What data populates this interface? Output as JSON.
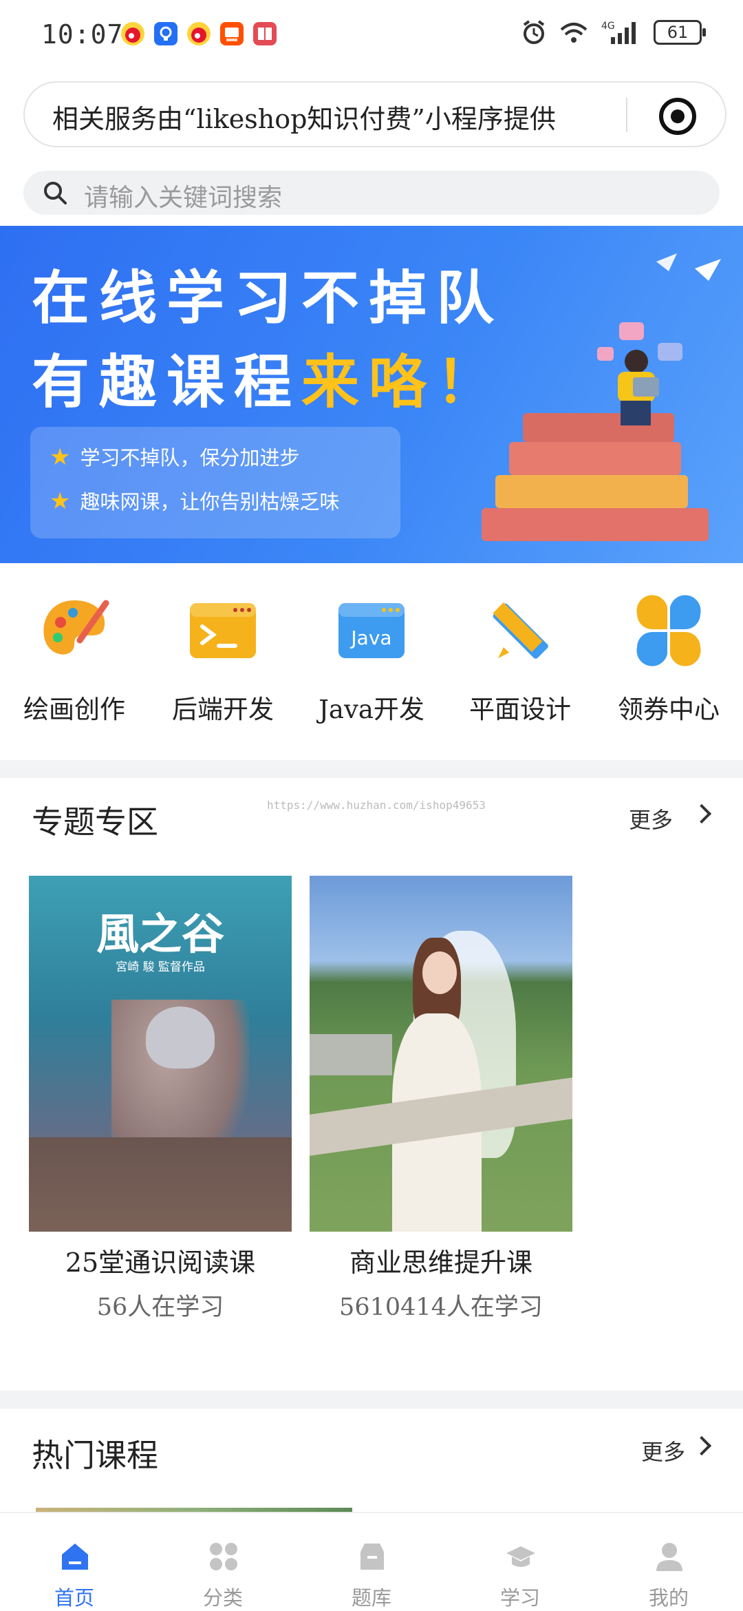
{
  "status_bar": {
    "time": "10:07",
    "battery": "61",
    "network": "4G"
  },
  "mini_program": {
    "text": "相关服务由“likeshop知识付费”小程序提供"
  },
  "search": {
    "placeholder": "请输入关键词搜索"
  },
  "banner": {
    "line1": "在线学习不掉队",
    "line2_prefix": "有趣课程",
    "line2_accent": "来咯！",
    "points": [
      "学习不掉队，保分加进步",
      "趣味网课，让你告别枯燥乏味"
    ]
  },
  "categories": [
    {
      "label": "绘画创作",
      "icon": "palette-icon"
    },
    {
      "label": "后端开发",
      "icon": "terminal-icon"
    },
    {
      "label": "Java开发",
      "icon": "java-window-icon"
    },
    {
      "label": "平面设计",
      "icon": "ruler-pencil-icon"
    },
    {
      "label": "领券中心",
      "icon": "coupon-grid-icon"
    }
  ],
  "topic_section": {
    "title": "专题专区",
    "more": "更多",
    "watermark": "https://www.huzhan.com/ishop49653",
    "cards": [
      {
        "title": "25堂通识阅读课",
        "subtitle": "56人在学习",
        "poster_title": "風之谷",
        "poster_sub": "宮崎 駿 監督作品"
      },
      {
        "title": "商业思维提升课",
        "subtitle": "5610414人在学习"
      }
    ]
  },
  "hot_section": {
    "title": "热门课程",
    "more": "更多"
  },
  "tabbar": {
    "tabs": [
      {
        "label": "首页",
        "icon": "home-icon",
        "active": true
      },
      {
        "label": "分类",
        "icon": "category-icon",
        "active": false
      },
      {
        "label": "题库",
        "icon": "question-bank-icon",
        "active": false
      },
      {
        "label": "学习",
        "icon": "graduation-cap-icon",
        "active": false
      },
      {
        "label": "我的",
        "icon": "profile-icon",
        "active": false
      }
    ]
  },
  "colors": {
    "primary": "#2f73f2",
    "accent": "#ffc21a",
    "banner": "#2e6ff2"
  }
}
